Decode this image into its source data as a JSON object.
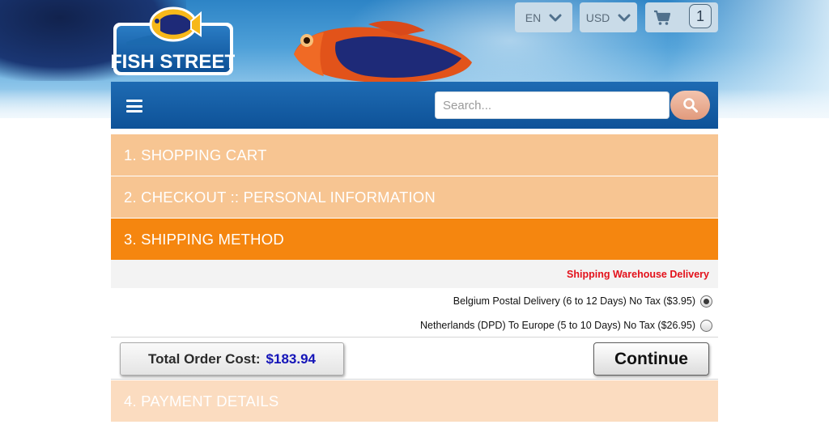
{
  "header": {
    "logo_text": "FISH STREET",
    "language": {
      "selected": "EN"
    },
    "currency": {
      "selected": "USD"
    },
    "cart": {
      "count": "1"
    }
  },
  "navbar": {
    "search": {
      "placeholder": "Search..."
    }
  },
  "steps": [
    {
      "label": "1. SHOPPING CART",
      "state": "completed"
    },
    {
      "label": "2. CHECKOUT :: PERSONAL INFORMATION",
      "state": "completed"
    },
    {
      "label": "3. SHIPPING METHOD",
      "state": "active"
    },
    {
      "label": "4. PAYMENT DETAILS",
      "state": "pending"
    }
  ],
  "shipping": {
    "warehouse_label": "Shipping Warehouse Delivery",
    "options": [
      {
        "label": "Belgium Postal Delivery (6 to 12 Days) No Tax ($3.95)",
        "selected": true
      },
      {
        "label": "Netherlands (DPD) To Europe (5 to 10 Days) No Tax ($26.95)",
        "selected": false
      }
    ]
  },
  "order": {
    "total_label": "Total Order Cost:",
    "total_value": "$183.94",
    "continue_label": "Continue"
  },
  "colors": {
    "nav_blue": "#0e5298",
    "step_completed": "#f7c592",
    "step_active": "#f5860f",
    "step_pending": "#fbdcc0",
    "warehouse_red": "#e3111b",
    "total_blue": "#1414b8"
  },
  "icons": {
    "menu": "hamburger-menu-icon",
    "search": "magnifier-icon",
    "cart": "shopping-cart-icon",
    "dropdown": "chevron-down-icon"
  }
}
